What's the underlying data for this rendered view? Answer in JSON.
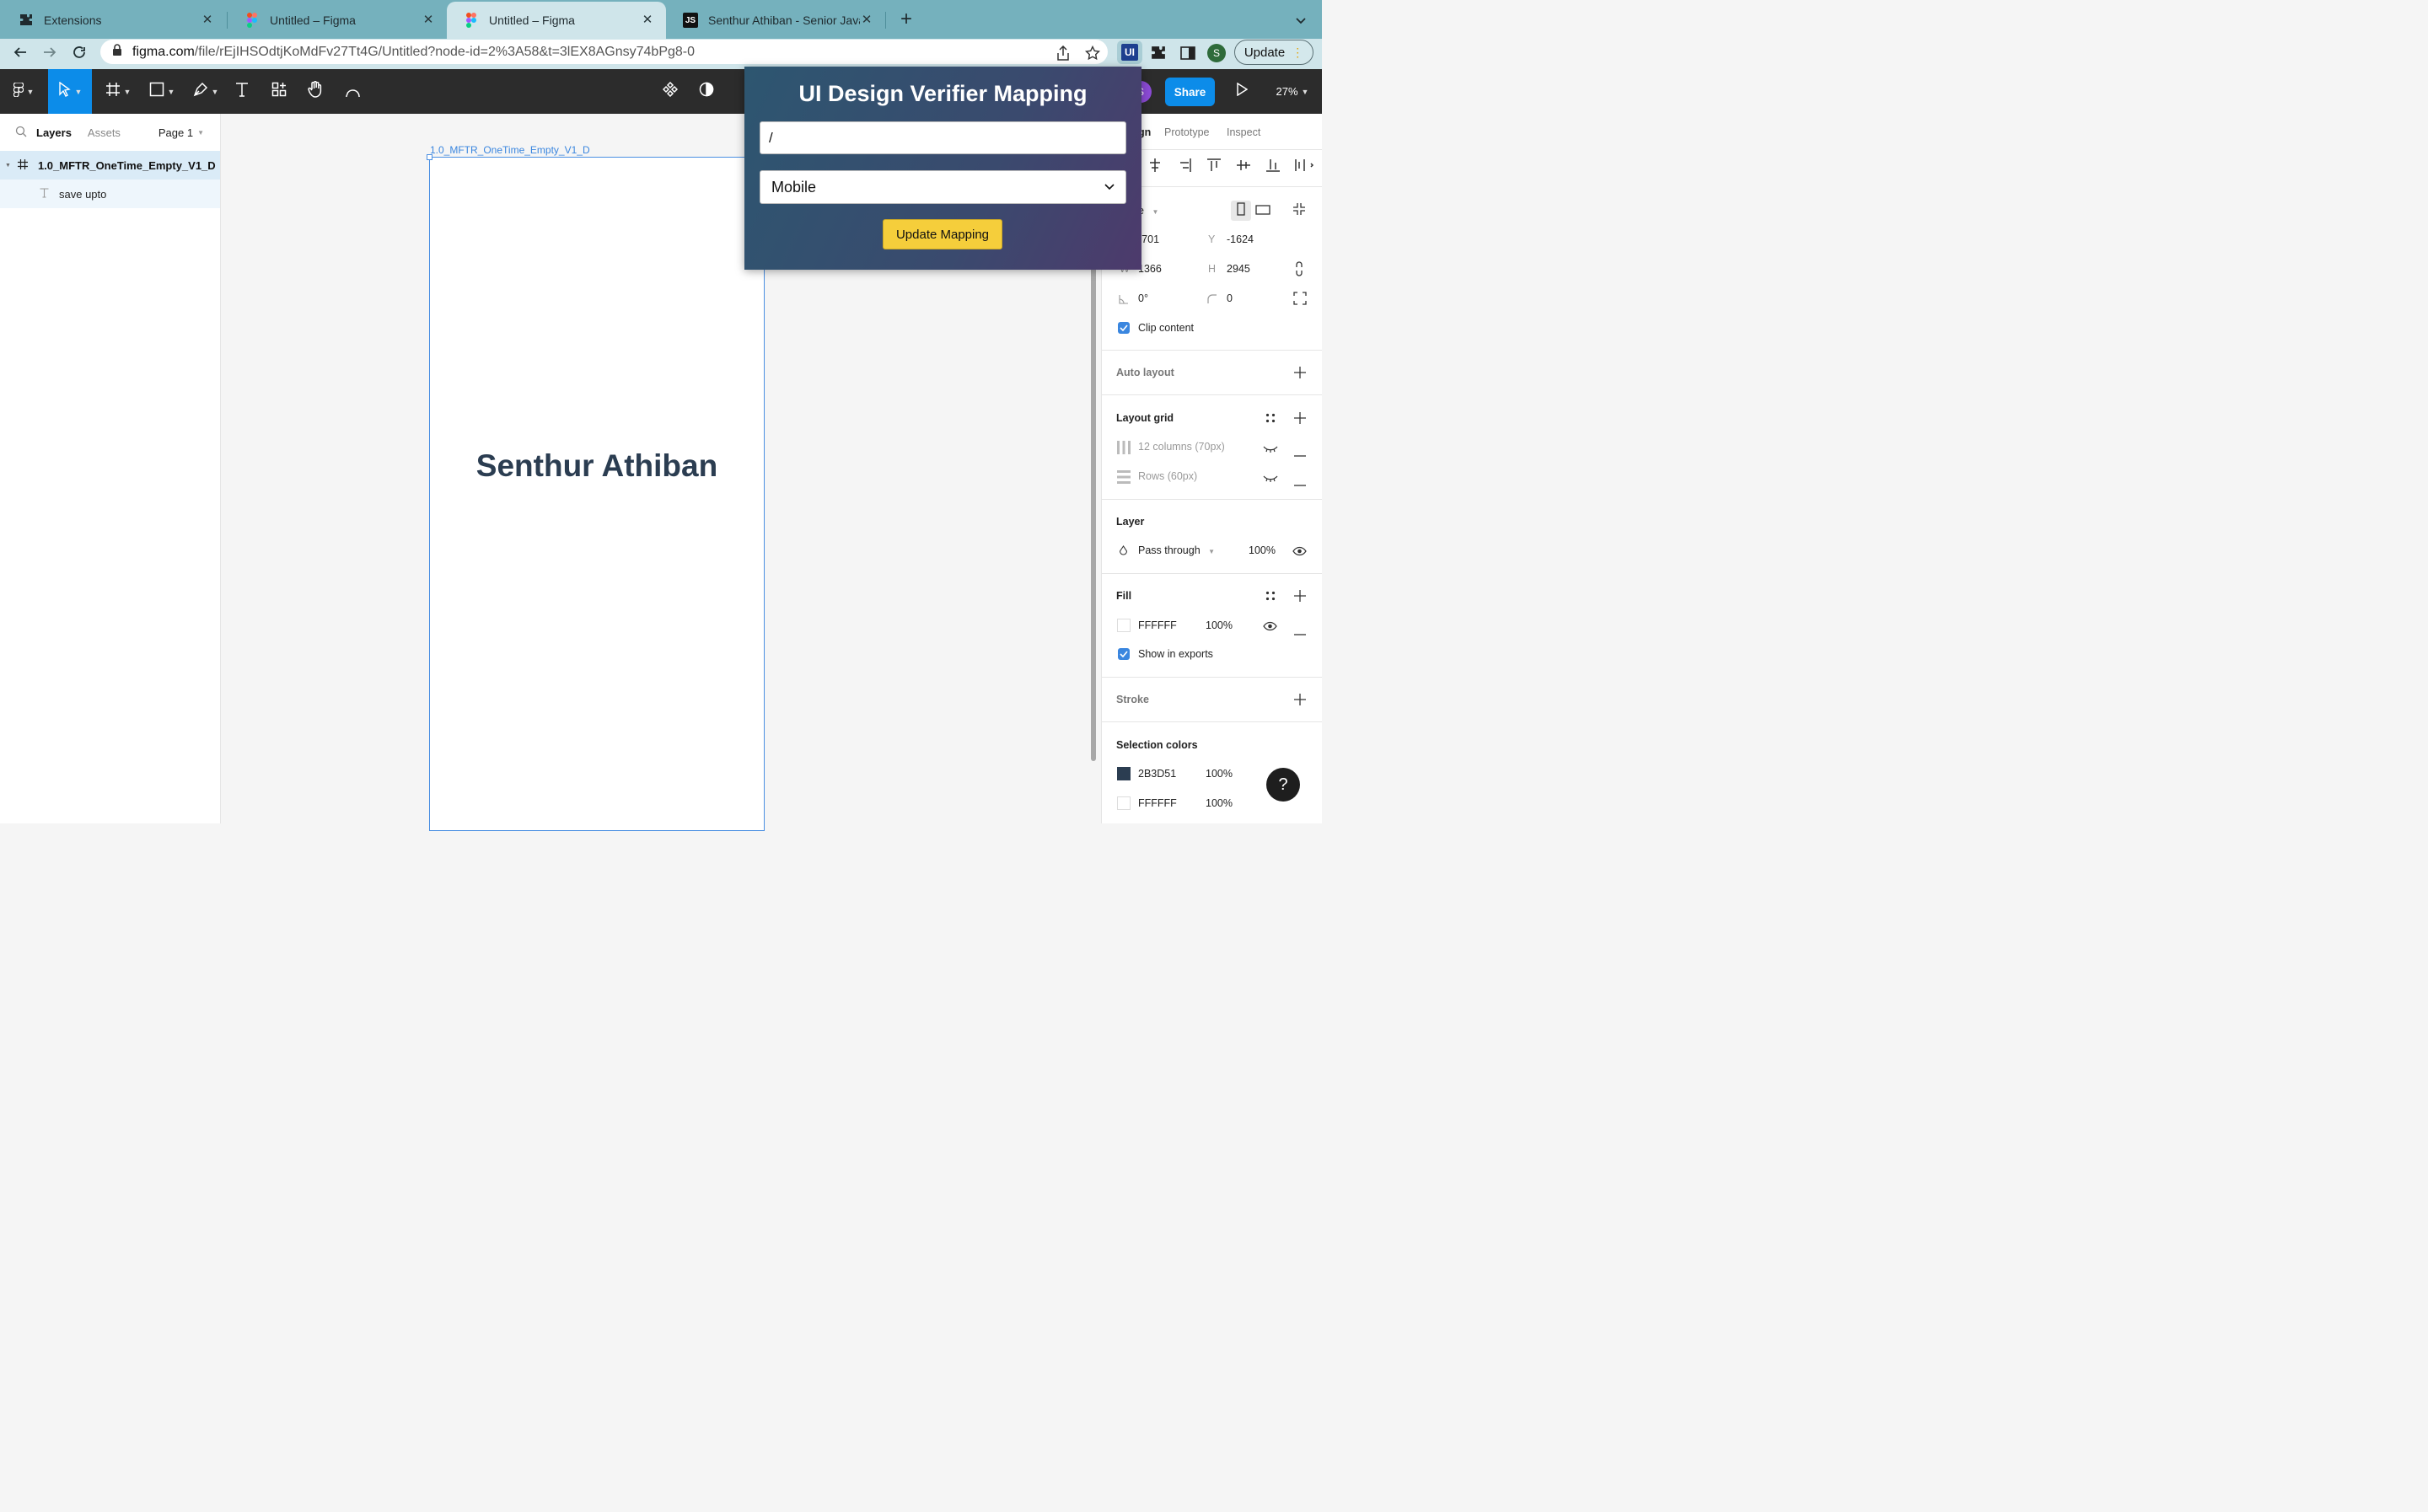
{
  "browser": {
    "tabs": [
      {
        "title": "Extensions",
        "icon": "puzzle-icon"
      },
      {
        "title": "Untitled – Figma",
        "icon": "figma-icon"
      },
      {
        "title": "Untitled – Figma",
        "icon": "figma-icon",
        "active": true
      },
      {
        "title": "Senthur Athiban - Senior Javascr",
        "icon": "js-icon"
      }
    ],
    "new_tab_label": "+",
    "tab_menu_icon": "chevron-down-icon",
    "url_domain": "figma.com",
    "url_path": "/file/rEjIHSOdtjKoMdFv27Tt4G/Untitled?node-id=2%3A58&t=3lEX8AGnsy74bPg8-0",
    "profile_initial": "S",
    "update_label": "Update",
    "ext_label": "UI"
  },
  "figma": {
    "zoom": "27%",
    "share_label": "Share",
    "avatar_initial": "S",
    "left": {
      "tab_layers": "Layers",
      "tab_assets": "Assets",
      "page": "Page 1",
      "layers": [
        {
          "name": "1.0_MFTR_OneTime_Empty_V1_D",
          "type": "frame"
        },
        {
          "name": "save upto",
          "type": "text"
        }
      ]
    },
    "canvas": {
      "frame_label": "1.0_MFTR_OneTime_Empty_V1_D",
      "heading": "Senthur Athiban"
    },
    "right": {
      "tabs": [
        "gn",
        "Prototype",
        "Inspect"
      ],
      "frame_type": "e",
      "x": "-701",
      "y_label": "Y",
      "y": "-1624",
      "w_label": "W",
      "w": "1366",
      "h_label": "H",
      "h": "2945",
      "rotation": "0°",
      "radius": "0",
      "clip_content": "Clip content",
      "auto_layout": "Auto layout",
      "layout_grid": "Layout grid",
      "grid_columns": "12 columns (70px)",
      "grid_rows": "Rows (60px)",
      "layer_title": "Layer",
      "blend": "Pass through",
      "layer_opacity": "100%",
      "fill_title": "Fill",
      "fill_hex": "FFFFFF",
      "fill_opacity": "100%",
      "show_exports": "Show in exports",
      "stroke_title": "Stroke",
      "selection_colors": "Selection colors",
      "sel_colors": [
        {
          "hex": "2B3D51",
          "opacity": "100%",
          "swatch": "#2b3d51"
        },
        {
          "hex": "FFFFFF",
          "opacity": "100%",
          "swatch": "#ffffff"
        }
      ]
    }
  },
  "popup": {
    "title": "UI Design Verifier Mapping",
    "path_value": "/",
    "device_value": "Mobile",
    "button_label": "Update Mapping"
  },
  "help_label": "?",
  "colors": {
    "tabstrip": "#75b1bd",
    "figma_toolbar": "#2c2c2c",
    "accent": "#3a86df",
    "share": "#3a86df",
    "button_yellow": "#f5ce3b",
    "heading": "#2b3d51"
  }
}
